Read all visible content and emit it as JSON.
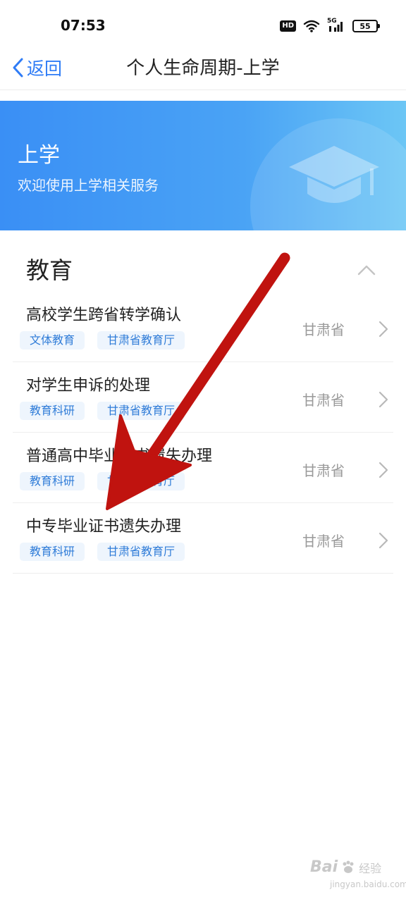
{
  "status_bar": {
    "time": "07:53",
    "hd_label": "HD",
    "network_label": "5G",
    "battery_level": "55"
  },
  "nav": {
    "back_label": "返回",
    "title": "个人生命周期-上学"
  },
  "banner": {
    "title": "上学",
    "subtitle": "欢迎使用上学相关服务",
    "icon": "graduation-cap-icon"
  },
  "section": {
    "title": "教育",
    "collapse_icon": "chevron-up-icon"
  },
  "items": [
    {
      "title": "高校学生跨省转学确认",
      "tags": [
        "文体教育",
        "甘肃省教育厅"
      ],
      "region": "甘肃省"
    },
    {
      "title": "对学生申诉的处理",
      "tags": [
        "教育科研",
        "甘肃省教育厅"
      ],
      "region": "甘肃省"
    },
    {
      "title": "普通高中毕业证书遗失办理",
      "tags": [
        "教育科研",
        "甘肃省教育厅"
      ],
      "region": "甘肃省"
    },
    {
      "title": "中专毕业证书遗失办理",
      "tags": [
        "教育科研",
        "甘肃省教育厅"
      ],
      "region": "甘肃省"
    }
  ],
  "watermark": {
    "logo": "Bai",
    "text": "经验",
    "url": "jingyan.baidu.com"
  },
  "colors": {
    "accent": "#2f7cf6",
    "banner_start": "#3a8ff5",
    "banner_end": "#6cc6f5",
    "tag_bg": "#eef5fd",
    "tag_text": "#2f7cd8",
    "annotation_arrow": "#c0130f"
  }
}
